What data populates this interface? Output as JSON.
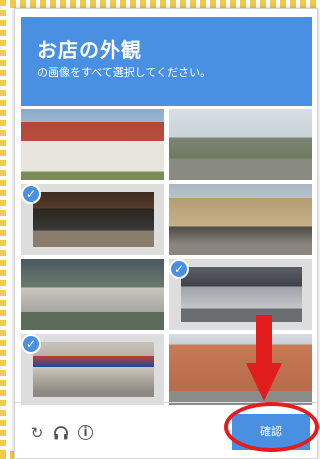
{
  "header": {
    "title": "お店の外観",
    "subtitle": "の画像をすべて選択してください。"
  },
  "tiles": [
    {
      "id": 1,
      "selected": false,
      "scene": "church-building"
    },
    {
      "id": 2,
      "selected": false,
      "scene": "houses-street"
    },
    {
      "id": 3,
      "selected": true,
      "scene": "storefront-la-perla"
    },
    {
      "id": 4,
      "selected": false,
      "scene": "parking-building"
    },
    {
      "id": 5,
      "selected": false,
      "scene": "overpass-street"
    },
    {
      "id": 6,
      "selected": true,
      "scene": "storefront-gray"
    },
    {
      "id": 7,
      "selected": true,
      "scene": "storefront-firestone"
    },
    {
      "id": 8,
      "selected": false,
      "scene": "apartment-building"
    }
  ],
  "footer": {
    "verify_label": "確認",
    "icons": [
      "reload-icon",
      "audio-icon",
      "info-icon"
    ]
  },
  "colors": {
    "brand": "#4a90e2",
    "annotation": "#e11d1d"
  }
}
